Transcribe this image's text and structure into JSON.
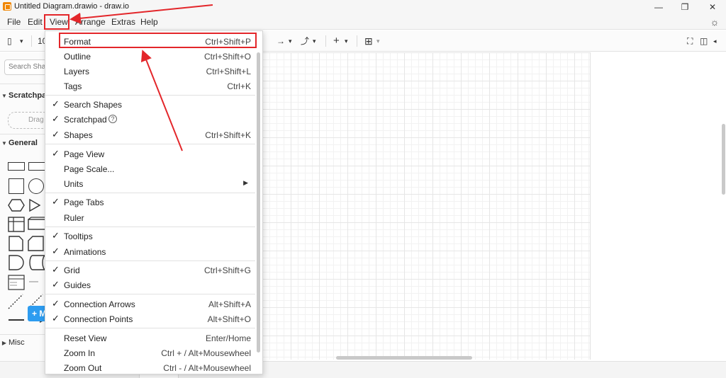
{
  "window": {
    "title": "Untitled Diagram.drawio - draw.io",
    "controls": {
      "minimize": "—",
      "restore": "❐",
      "close": "✕"
    }
  },
  "menubar": {
    "items": [
      "File",
      "Edit",
      "View",
      "Arrange",
      "Extras",
      "Help"
    ]
  },
  "toolbar": {
    "zoom": "10",
    "connector": "→",
    "waypoint": "⤴",
    "insert": "+",
    "table": "⊞",
    "fullscreen": "⛶",
    "format_panel": "◫",
    "chevron": "▾"
  },
  "sidebar": {
    "search_placeholder": "Search Shapes",
    "scratchpad_label": "Scratchpad",
    "drag_hint": "Drag elements here",
    "general_label": "General",
    "misc_label": "Misc",
    "more_label": "+ M"
  },
  "view_menu": {
    "items": [
      {
        "label": "Format",
        "shortcut": "Ctrl+Shift+P",
        "checked": false
      },
      {
        "label": "Outline",
        "shortcut": "Ctrl+Shift+O",
        "checked": false
      },
      {
        "label": "Layers",
        "shortcut": "Ctrl+Shift+L",
        "checked": false
      },
      {
        "label": "Tags",
        "shortcut": "Ctrl+K",
        "checked": false
      },
      {
        "label": "Search Shapes",
        "shortcut": "",
        "checked": true
      },
      {
        "label": "Scratchpad",
        "shortcut": "",
        "checked": true
      },
      {
        "label": "Shapes",
        "shortcut": "Ctrl+Shift+K",
        "checked": true
      },
      {
        "label": "Page View",
        "shortcut": "",
        "checked": true
      },
      {
        "label": "Page Scale...",
        "shortcut": "",
        "checked": false
      },
      {
        "label": "Units",
        "shortcut": "",
        "checked": false
      },
      {
        "label": "Page Tabs",
        "shortcut": "",
        "checked": true
      },
      {
        "label": "Ruler",
        "shortcut": "",
        "checked": false
      },
      {
        "label": "Tooltips",
        "shortcut": "",
        "checked": true
      },
      {
        "label": "Animations",
        "shortcut": "",
        "checked": true
      },
      {
        "label": "Grid",
        "shortcut": "Ctrl+Shift+G",
        "checked": true
      },
      {
        "label": "Guides",
        "shortcut": "",
        "checked": true
      },
      {
        "label": "Connection Arrows",
        "shortcut": "Alt+Shift+A",
        "checked": true
      },
      {
        "label": "Connection Points",
        "shortcut": "Alt+Shift+O",
        "checked": true
      },
      {
        "label": "Reset View",
        "shortcut": "Enter/Home",
        "checked": false
      },
      {
        "label": "Zoom In",
        "shortcut": "Ctrl + / Alt+Mousewheel",
        "checked": false
      },
      {
        "label": "Zoom Out",
        "shortcut": "Ctrl - / Alt+Mousewheel",
        "checked": false
      }
    ],
    "check_glyph": "✓",
    "submenu_glyph": "▶",
    "help_glyph": "?"
  },
  "colors": {
    "annotation": "#e3262a",
    "accent": "#2d9cf0",
    "brand": "#f08705"
  }
}
